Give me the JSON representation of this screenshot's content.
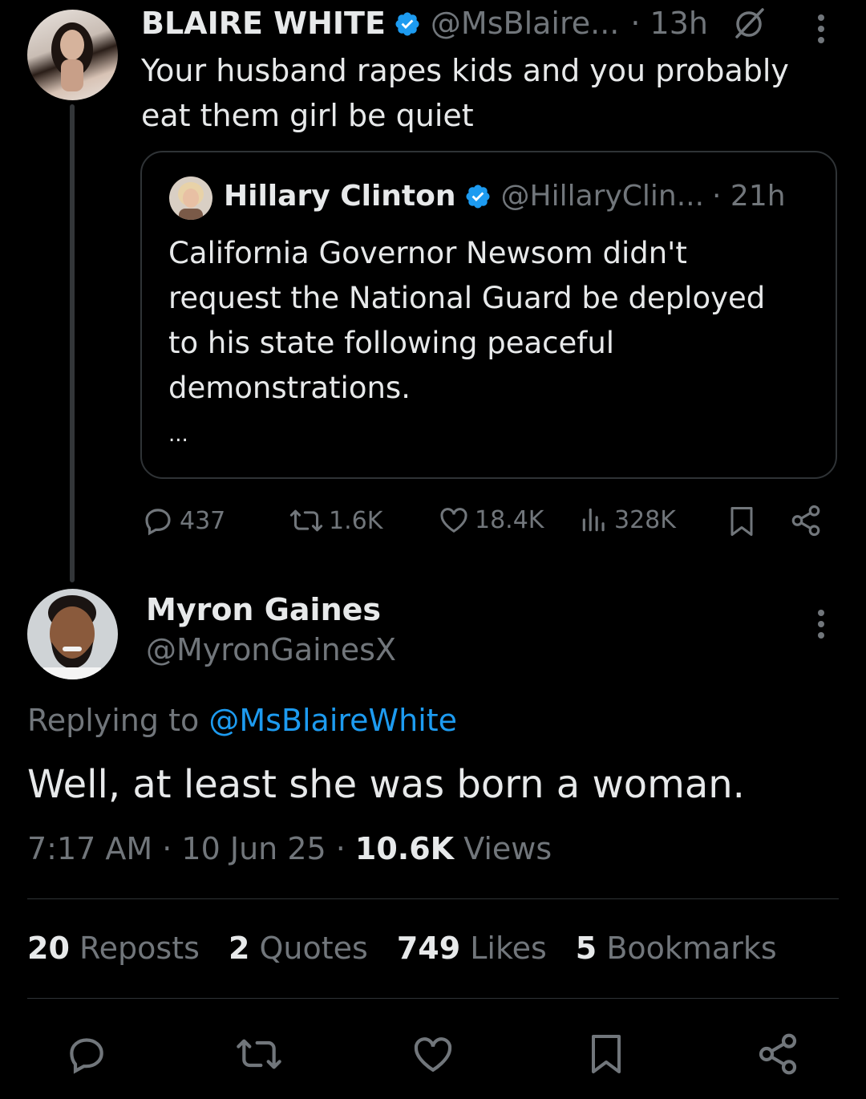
{
  "parent_tweet": {
    "display_name": "BLAIRE WHITE",
    "handle": "@MsBlaire...",
    "time": "· 13h",
    "text_line1": "Your husband rapes kids and you probably",
    "text_line2": "eat them girl be quiet",
    "quoted": {
      "display_name": "Hillary Clinton",
      "handle": "@HillaryClin...",
      "time": "· 21h",
      "lines": [
        "California Governor Newsom didn't",
        "request the National Guard be deployed",
        "to his state following peaceful",
        "demonstrations."
      ],
      "more": "..."
    },
    "actions": {
      "replies": "437",
      "reposts": "1.6K",
      "likes": "18.4K",
      "views": "328K"
    }
  },
  "main_tweet": {
    "display_name": "Myron Gaines",
    "handle": "@MyronGainesX",
    "replying_prefix": "Replying to",
    "replying_to": "@MsBlaireWhite",
    "text": "Well, at least she was born a woman.",
    "timestamp": "7:17 AM · 10 Jun 25 · ",
    "views_count": "10.6K",
    "views_label": " Views",
    "stats": [
      {
        "num": "20",
        "label": "Reposts"
      },
      {
        "num": "2",
        "label": "Quotes"
      },
      {
        "num": "749",
        "label": "Likes"
      },
      {
        "num": "5",
        "label": "Bookmarks"
      }
    ]
  },
  "colors": {
    "background": "#000000",
    "text": "#e7e9ea",
    "muted": "#71767b",
    "link": "#1d9bf0",
    "border": "#2f3336",
    "verified": "#1d9bf0"
  }
}
